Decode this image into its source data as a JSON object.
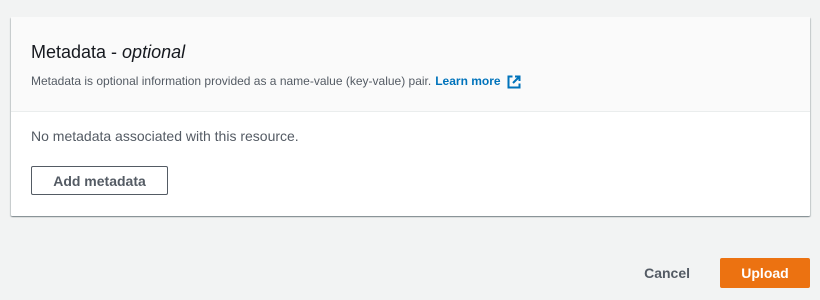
{
  "metadata_panel": {
    "title": "Metadata - ",
    "title_optional": "optional",
    "description": "Metadata is optional information provided as a name-value (key-value) pair.",
    "learn_more_label": "Learn more",
    "empty_message": "No metadata associated with this resource.",
    "add_button_label": "Add metadata"
  },
  "footer": {
    "cancel_label": "Cancel",
    "upload_label": "Upload"
  },
  "colors": {
    "primary": "#ec7211",
    "link": "#0073bb",
    "page_background": "#f2f3f3"
  },
  "icons": {
    "learn_more": "external-link-icon"
  }
}
